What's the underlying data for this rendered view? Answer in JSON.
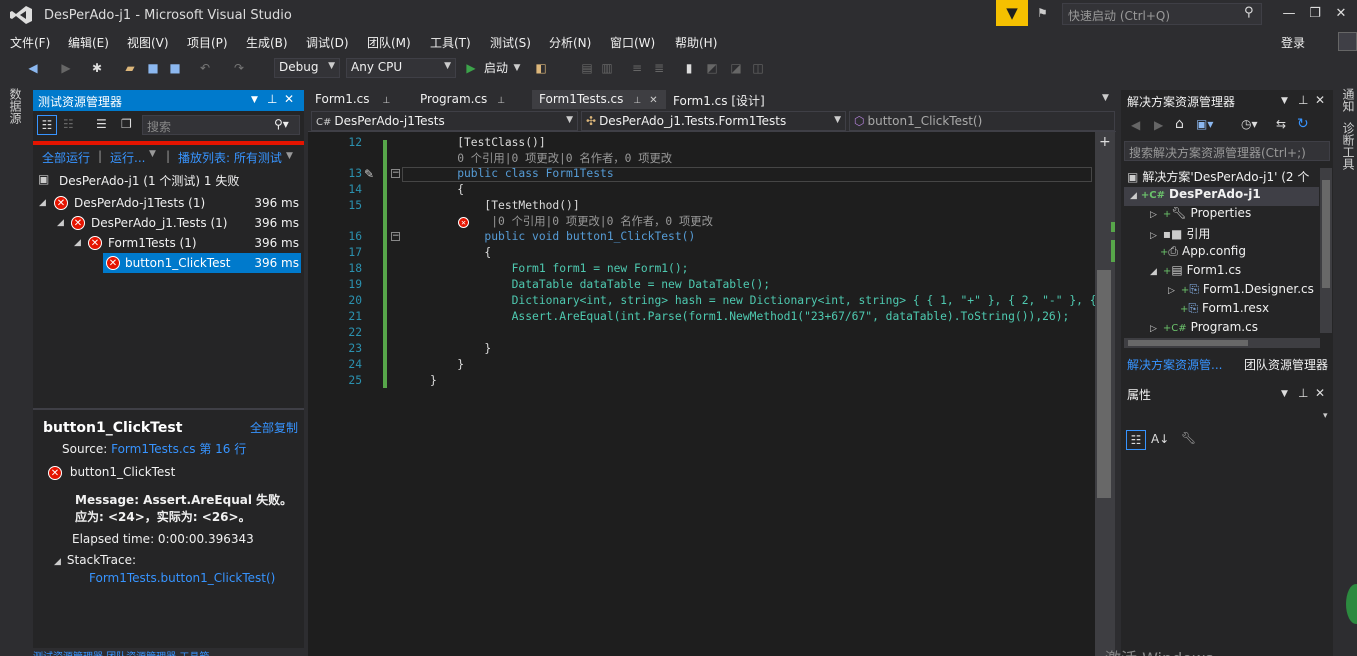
{
  "window": {
    "title": "DesPerAdo-j1 - Microsoft Visual Studio",
    "quick_launch_placeholder": "快速启动 (Ctrl+Q)",
    "login": "登录"
  },
  "menu": [
    "文件(F)",
    "编辑(E)",
    "视图(V)",
    "项目(P)",
    "生成(B)",
    "调试(D)",
    "团队(M)",
    "工具(T)",
    "测试(S)",
    "分析(N)",
    "窗口(W)",
    "帮助(H)"
  ],
  "toolbar": {
    "config": "Debug",
    "platform": "Any CPU",
    "start_label": "启动"
  },
  "left_strip": {
    "vertical_tab": "数据源"
  },
  "test_explorer": {
    "title": "测试资源管理器",
    "search_placeholder": "搜索",
    "actions": {
      "run_all": "全部运行",
      "run": "运行...",
      "playlist": "播放列表: 所有测试"
    },
    "summary": "DesPerAdo-j1 (1 个测试) 1 失败",
    "tree": [
      {
        "label": "DesPerAdo-j1Tests (1)",
        "time": "396 ms"
      },
      {
        "label": "DesPerAdo_j1.Tests (1)",
        "time": "396 ms"
      },
      {
        "label": "Form1Tests (1)",
        "time": "396 ms"
      },
      {
        "label": "button1_ClickTest",
        "time": "396 ms"
      }
    ],
    "detail": {
      "title": "button1_ClickTest",
      "copy_all": "全部复制",
      "source_label": "Source:",
      "source_link": "Form1Tests.cs 第 16 行",
      "test_name": "button1_ClickTest",
      "message": "Message: Assert.AreEqual 失败。应为: <24>，实际为: <26>。",
      "elapsed": "Elapsed time: 0:00:00.396343",
      "stacktrace_label": "StackTrace:",
      "stacktrace_link": "Form1Tests.button1_ClickTest()"
    },
    "bottom_tabs": "测试资源管理器   团队资源管理器   工具箱"
  },
  "editor": {
    "tabs": [
      {
        "label": "Form1.cs"
      },
      {
        "label": "Program.cs"
      },
      {
        "label": "Form1Tests.cs"
      },
      {
        "label": "Form1.cs [设计]"
      }
    ],
    "nav": {
      "project": "DesPerAdo-j1Tests",
      "class": "DesPerAdo_j1.Tests.Form1Tests",
      "member": "button1_ClickTest()"
    },
    "lines": [
      {
        "num": "12",
        "text": "    [TestClass()]"
      },
      {
        "num": "",
        "text": "    0 个引用|0 项更改|0 名作者，0 项更改"
      },
      {
        "num": "13",
        "text": "    public class Form1Tests"
      },
      {
        "num": "14",
        "text": "    {"
      },
      {
        "num": "15",
        "text": "        [TestMethod()]"
      },
      {
        "num": "",
        "text": "         |0 个引用|0 项更改|0 名作者，0 项更改"
      },
      {
        "num": "16",
        "text": "        public void button1_ClickTest()"
      },
      {
        "num": "17",
        "text": "        {"
      },
      {
        "num": "18",
        "text": "            Form1 form1 = new Form1();"
      },
      {
        "num": "19",
        "text": "            DataTable dataTable = new DataTable();"
      },
      {
        "num": "20",
        "text": "            Dictionary<int, string> hash = new Dictionary<int, string> { { 1, \"+\" }, { 2, \"-\" }, {"
      },
      {
        "num": "21",
        "text": "            Assert.AreEqual(int.Parse(form1.NewMethod1(\"23+67/67\", dataTable).ToString()),26);"
      },
      {
        "num": "22",
        "text": ""
      },
      {
        "num": "23",
        "text": "        }"
      },
      {
        "num": "24",
        "text": "    }"
      },
      {
        "num": "25",
        "text": "}"
      }
    ]
  },
  "solution_explorer": {
    "title": "解决方案资源管理器",
    "search_placeholder": "搜索解决方案资源管理器(Ctrl+;)",
    "items": [
      {
        "label": "解决方案'DesPerAdo-j1' (2 个"
      },
      {
        "label": "DesPerAdo-j1"
      },
      {
        "label": "Properties"
      },
      {
        "label": "引用"
      },
      {
        "label": "App.config"
      },
      {
        "label": "Form1.cs"
      },
      {
        "label": "Form1.Designer.cs"
      },
      {
        "label": "Form1.resx"
      },
      {
        "label": "Program.cs"
      }
    ],
    "tabs": [
      "解决方案资源管...",
      "团队资源管理器"
    ]
  },
  "properties": {
    "title": "属性"
  },
  "right_strip": [
    "通知",
    "诊断工具"
  ],
  "watermark": "激活 Windows"
}
